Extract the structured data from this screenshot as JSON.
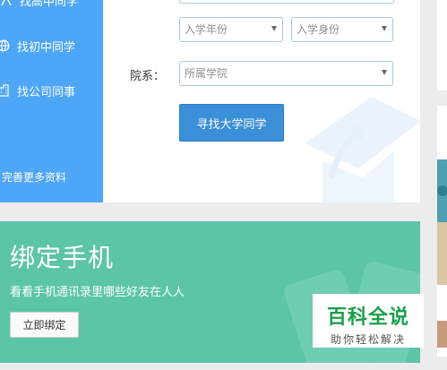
{
  "sidebar": {
    "items": [
      {
        "label": "找高中同学",
        "icon": "school-icon"
      },
      {
        "label": "找初中同学",
        "icon": "globe-icon"
      },
      {
        "label": "找公司同事",
        "icon": "building-icon"
      }
    ],
    "more_label": "完善更多资料"
  },
  "form": {
    "year_select": "入学年份",
    "identity_select": "入学身份",
    "dept_label": "院系：",
    "dept_select": "所属学院",
    "find_button": "寻找大学同学"
  },
  "phone_banner": {
    "title": "绑定手机",
    "description": "看看手机通讯录里哪些好友在人人",
    "bind_button": "立即绑定"
  },
  "watermark": {
    "brand": "百科全说",
    "slogan": "助你轻松解决"
  },
  "colors": {
    "sidebar": "#4ea6f7",
    "button": "#3b8fd9",
    "banner": "#5cc5a7",
    "watermark_green": "#1c9e4c"
  }
}
